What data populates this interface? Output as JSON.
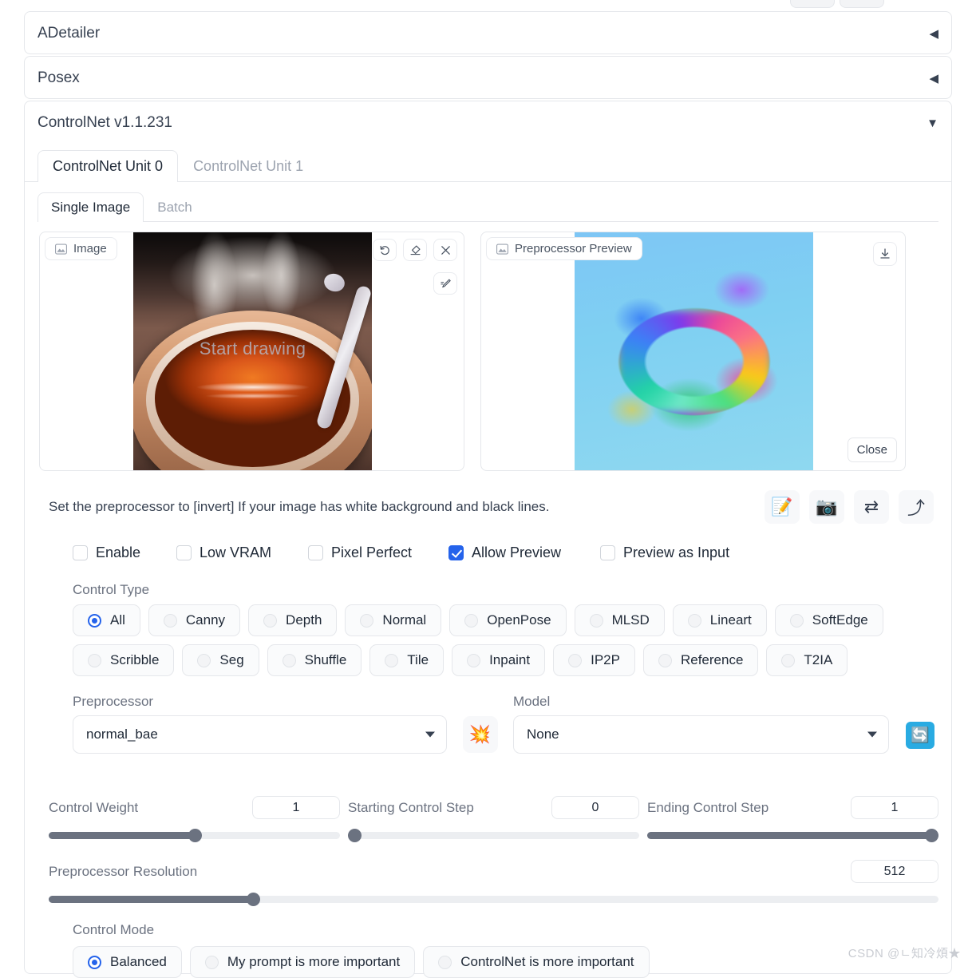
{
  "top_partial_buttons": [
    "",
    ""
  ],
  "panels": [
    {
      "title": "ADetailer",
      "arrow": "◀"
    },
    {
      "title": "Posex",
      "arrow": "◀"
    },
    {
      "title": "ControlNet v1.1.231",
      "arrow": "▼"
    }
  ],
  "unit_tabs": [
    {
      "label": "ControlNet Unit 0",
      "active": true
    },
    {
      "label": "ControlNet Unit 1",
      "active": false
    }
  ],
  "source_tabs": [
    {
      "label": "Single Image",
      "active": true
    },
    {
      "label": "Batch",
      "active": false
    }
  ],
  "image_panel": {
    "badge": "Image",
    "badge_icon": "image-placeholder-icon",
    "overlay_text": "Start drawing",
    "tools": [
      {
        "name": "undo-icon",
        "glyph": "↺"
      },
      {
        "name": "eraser-icon",
        "glyph": "◇"
      },
      {
        "name": "close-icon",
        "glyph": "✕"
      }
    ],
    "tool_secondary": {
      "name": "brush-icon",
      "glyph": "✒"
    }
  },
  "preview_panel": {
    "badge": "Preprocessor Preview",
    "badge_icon": "image-placeholder-icon",
    "download_icon": "download-icon",
    "close_label": "Close"
  },
  "hint": {
    "text": "Set the preprocessor to [invert] If your image has white background and black lines.",
    "buttons": [
      {
        "name": "memo-icon",
        "glyph": "📝"
      },
      {
        "name": "camera-icon",
        "glyph": "📷"
      },
      {
        "name": "swap-arrows-icon",
        "glyph": "⇄"
      },
      {
        "name": "arrow-up-right-icon",
        "glyph": "⤴"
      }
    ]
  },
  "checkboxes": [
    {
      "label": "Enable",
      "checked": false
    },
    {
      "label": "Low VRAM",
      "checked": false
    },
    {
      "label": "Pixel Perfect",
      "checked": false
    },
    {
      "label": "Allow Preview",
      "checked": true
    },
    {
      "label": "Preview as Input",
      "checked": false
    }
  ],
  "control_type": {
    "label": "Control Type",
    "options": [
      {
        "label": "All",
        "selected": true
      },
      {
        "label": "Canny",
        "selected": false
      },
      {
        "label": "Depth",
        "selected": false
      },
      {
        "label": "Normal",
        "selected": false
      },
      {
        "label": "OpenPose",
        "selected": false
      },
      {
        "label": "MLSD",
        "selected": false
      },
      {
        "label": "Lineart",
        "selected": false
      },
      {
        "label": "SoftEdge",
        "selected": false
      },
      {
        "label": "Scribble",
        "selected": false
      },
      {
        "label": "Seg",
        "selected": false
      },
      {
        "label": "Shuffle",
        "selected": false
      },
      {
        "label": "Tile",
        "selected": false
      },
      {
        "label": "Inpaint",
        "selected": false
      },
      {
        "label": "IP2P",
        "selected": false
      },
      {
        "label": "Reference",
        "selected": false
      },
      {
        "label": "T2IA",
        "selected": false
      }
    ]
  },
  "preprocessor": {
    "label": "Preprocessor",
    "value": "normal_bae",
    "run_button_icon": "explosion-icon",
    "run_button_glyph": "💥"
  },
  "model": {
    "label": "Model",
    "value": "None",
    "refresh_icon": "refresh-icon",
    "refresh_glyph": "🔄"
  },
  "sliders": [
    {
      "label": "Control Weight",
      "value": "1",
      "percent": 50
    },
    {
      "label": "Starting Control Step",
      "value": "0",
      "percent": 0
    },
    {
      "label": "Ending Control Step",
      "value": "1",
      "percent": 100
    },
    {
      "label": "Preprocessor Resolution",
      "value": "512",
      "percent": 23
    }
  ],
  "control_mode": {
    "label": "Control Mode",
    "options": [
      {
        "label": "Balanced",
        "selected": true
      },
      {
        "label": "My prompt is more important",
        "selected": false
      },
      {
        "label": "ControlNet is more important",
        "selected": false
      }
    ]
  },
  "watermark": "CSDN @ㄴ知冷煩★",
  "colors": {
    "accent_blue": "#2563eb",
    "refresh_blue": "#29abe2",
    "slider_gray": "#6b7280",
    "border": "#e5e7eb"
  }
}
